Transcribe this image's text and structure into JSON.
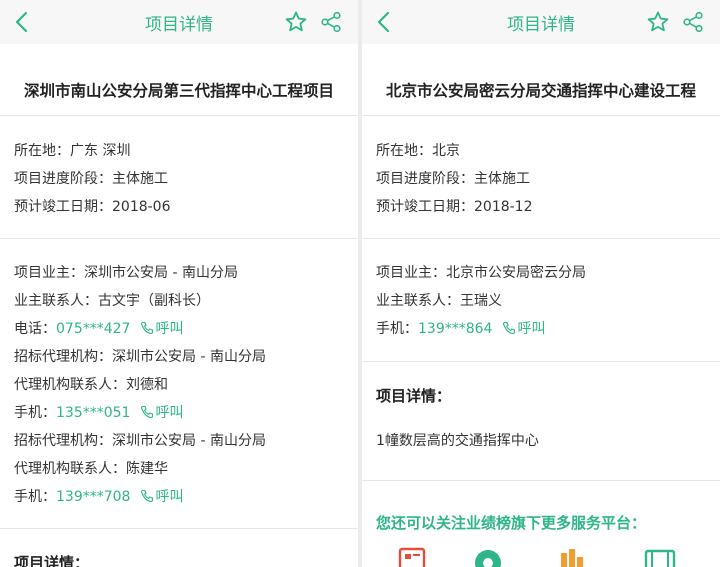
{
  "left": {
    "header_title": "项目详情",
    "project_title": "深圳市南山公安分局第三代指挥中心工程项目",
    "location": "所在地：广东 深圳",
    "stage": "项目进度阶段：主体施工",
    "completion": "预计竣工日期：2018-06",
    "owner": "项目业主：深圳市公安局 - 南山分局",
    "owner_contact": "业主联系人：古文宇（副科长）",
    "phone1_label": "电话：",
    "phone1": "075***427",
    "call_label": "呼叫",
    "agency1": "招标代理机构：深圳市公安局 - 南山分局",
    "agency1_contact": "代理机构联系人：刘德和",
    "phone2_label": "手机：",
    "phone2": "135***051",
    "agency2": "招标代理机构：深圳市公安局 - 南山分局",
    "agency2_contact": "代理机构联系人：陈建华",
    "phone3_label": "手机：",
    "phone3": "139***708",
    "details_heading": "项目详情："
  },
  "right": {
    "header_title": "项目详情",
    "project_title": "北京市公安局密云分局交通指挥中心建设工程",
    "location": "所在地：北京",
    "stage": "项目进度阶段：主体施工",
    "completion": "预计竣工日期：2018-12",
    "owner": "项目业主：北京市公安局密云分局",
    "owner_contact": "业主联系人：王瑞义",
    "phone_label": "手机：",
    "phone": "139***864",
    "call_label": "呼叫",
    "details_heading": "项目详情：",
    "details_text": "1幢数层高的交通指挥中心",
    "promo_text": "您还可以关注业绩榜旗下更多服务平台："
  },
  "colors": {
    "accent": "#2fb58a",
    "promo_red": "#e94b3c",
    "promo_orange": "#f39c2f"
  },
  "icons": [
    "back-arrow-icon",
    "star-icon",
    "share-icon",
    "phone-call-icon",
    "newspaper-icon",
    "aperture-icon",
    "bar-chart-icon",
    "film-icon"
  ]
}
